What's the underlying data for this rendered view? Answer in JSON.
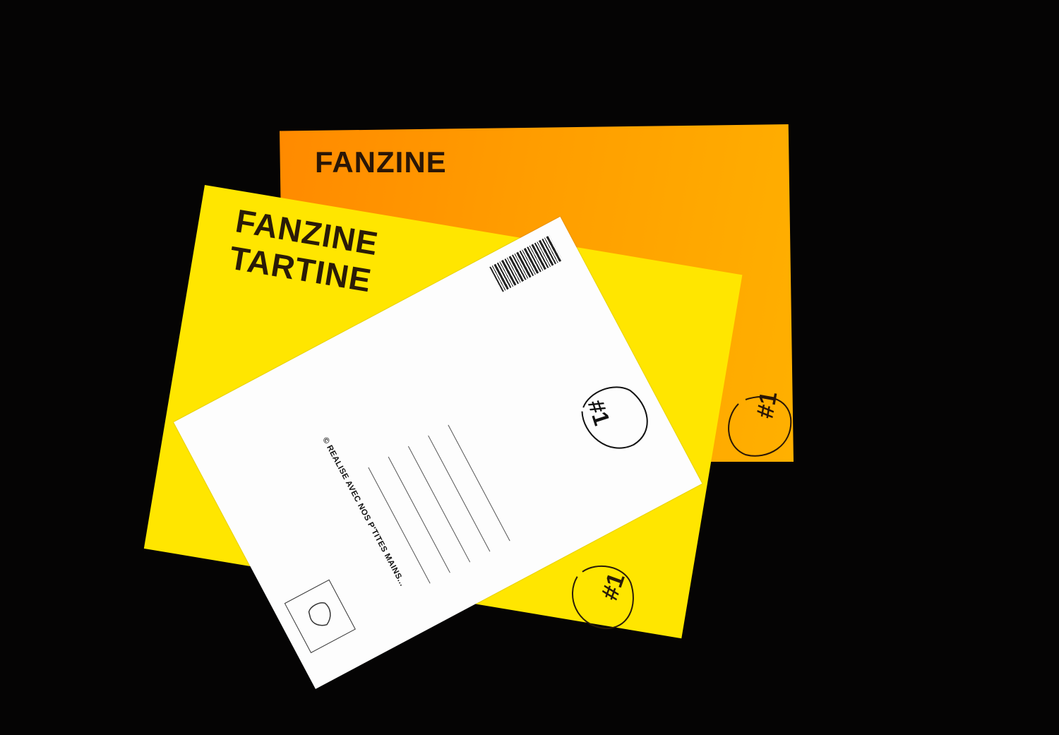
{
  "scene": {
    "background_color": "#050404",
    "orange_cover": {
      "color": "#ff9d00",
      "title_visible": "FANZINE",
      "issue_number": "#1"
    },
    "yellow_cover": {
      "color": "#ffe600",
      "title_line1": "FANZINE",
      "title_line2": "TARTINE",
      "issue_number": "#1"
    },
    "postcard": {
      "color": "#fdfdfd",
      "credit_text": "© REALISE AVEC NOS P'TITES MAINS...",
      "issue_number": "#1",
      "has_barcode": true,
      "address_lines": 5
    }
  }
}
